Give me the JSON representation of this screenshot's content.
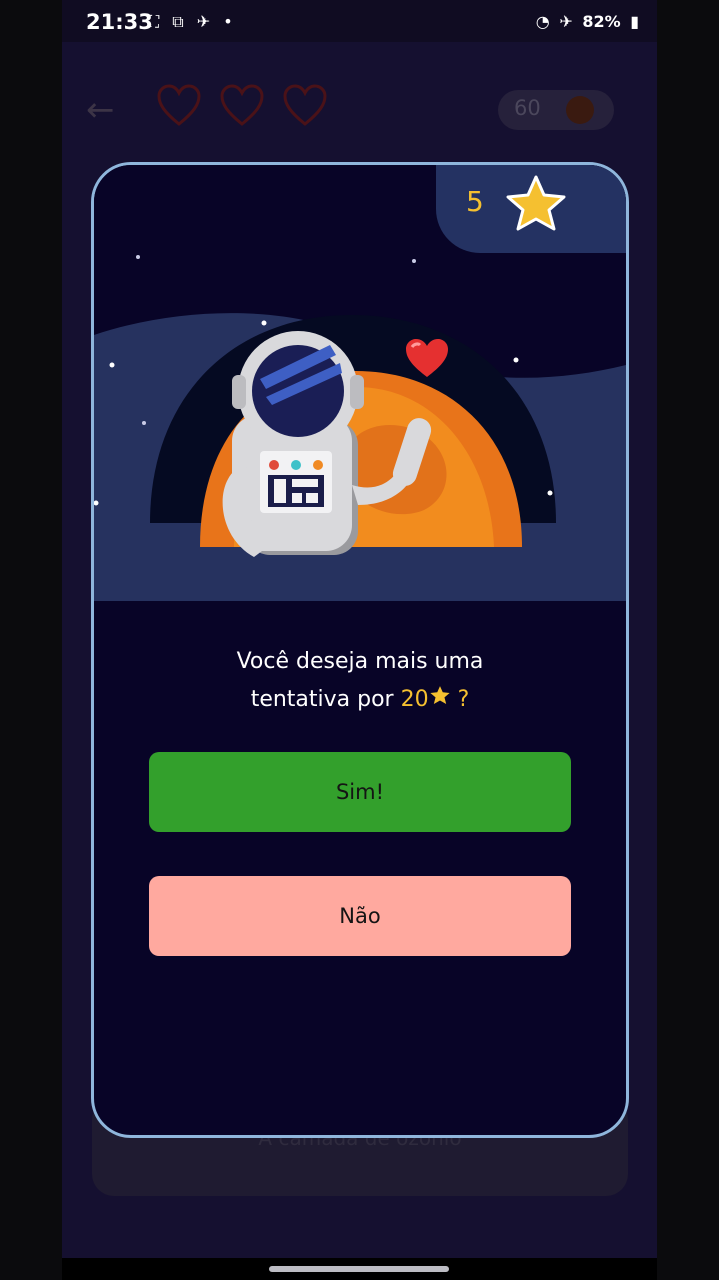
{
  "status_bar": {
    "time": "21:33",
    "battery": "82%"
  },
  "game": {
    "timer_value": "60",
    "answer_text": "A camada de ozônio"
  },
  "modal": {
    "stars_count": "5",
    "question_line1": "Você deseja mais uma",
    "question_line2_prefix": "tentativa por",
    "price": "20",
    "question_end": "?",
    "yes_label": "Sim!",
    "no_label": "Não"
  },
  "colors": {
    "accent_star": "#f5c030",
    "yes_button": "#33a02c",
    "no_button": "#ffa99f",
    "modal_border": "#8fb6dc"
  },
  "icons": [
    "back-arrow-icon",
    "heart-outline-icon",
    "clock-icon",
    "star-icon",
    "heart-icon"
  ]
}
